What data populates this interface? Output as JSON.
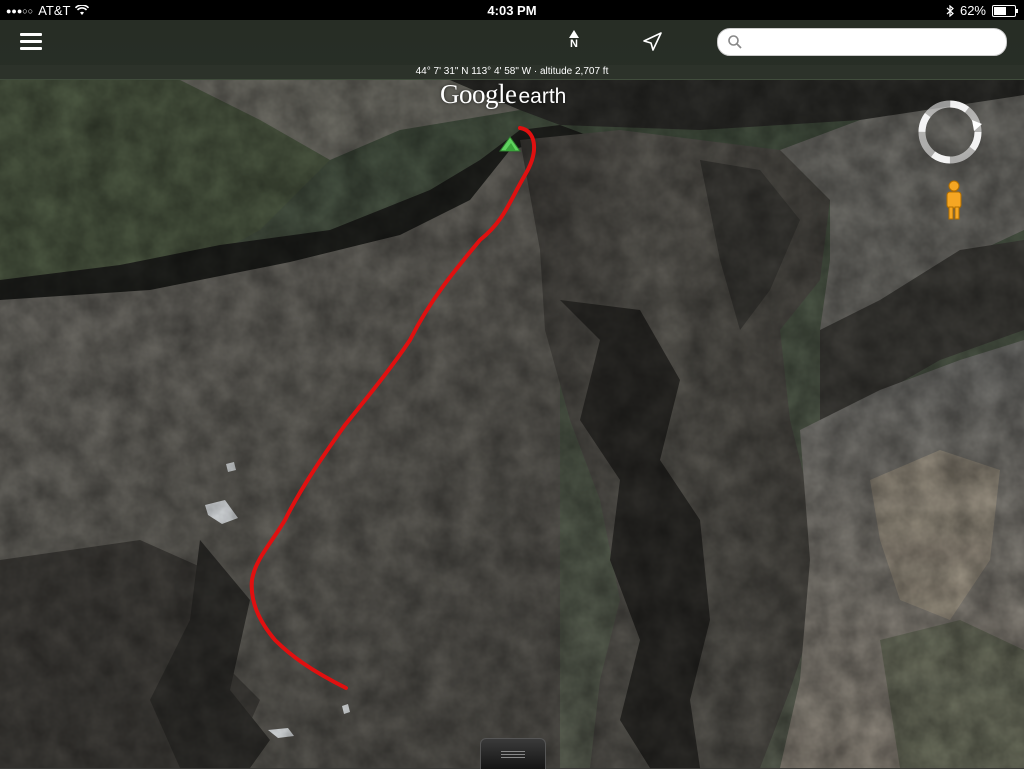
{
  "status_bar": {
    "carrier": "AT&T",
    "time": "4:03 PM",
    "battery": "62%",
    "battery_level": 0.62
  },
  "toolbar": {
    "north_label": "N",
    "search_placeholder": "",
    "icons": [
      "menu-icon",
      "north-arrow-icon",
      "location-arrow-icon",
      "search-icon"
    ]
  },
  "coordinates_text": "44° 7' 31\" N  113° 4' 58\" W · altitude 2,707 ft",
  "logo": {
    "google": "Google",
    "earth": "earth"
  },
  "map": {
    "route_color": "#e01010",
    "summit_marker_color": "#5fd35f",
    "icons": [
      "summit-marker-icon",
      "navigation-ring-icon",
      "pegman-icon"
    ]
  }
}
